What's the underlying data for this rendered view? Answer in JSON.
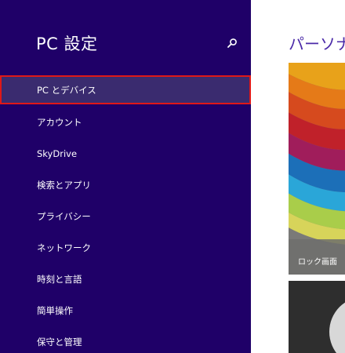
{
  "sidebar": {
    "title": "PC 設定",
    "items": [
      {
        "label": "PC とデバイス",
        "selected": true
      },
      {
        "label": "アカウント"
      },
      {
        "label": "SkyDrive"
      },
      {
        "label": "検索とアプリ"
      },
      {
        "label": "プライバシー"
      },
      {
        "label": "ネットワーク"
      },
      {
        "label": "時刻と言語"
      },
      {
        "label": "簡単操作"
      },
      {
        "label": "保守と管理"
      }
    ]
  },
  "main": {
    "title": "パーソナラ",
    "tiles": {
      "lock_screen_label": "ロック画面"
    }
  },
  "colors": {
    "sidebar_bg": "#1f0068",
    "selected_bg": "#3a2b6f",
    "selection_outline": "#e01818",
    "main_title": "#4b2aa8"
  }
}
